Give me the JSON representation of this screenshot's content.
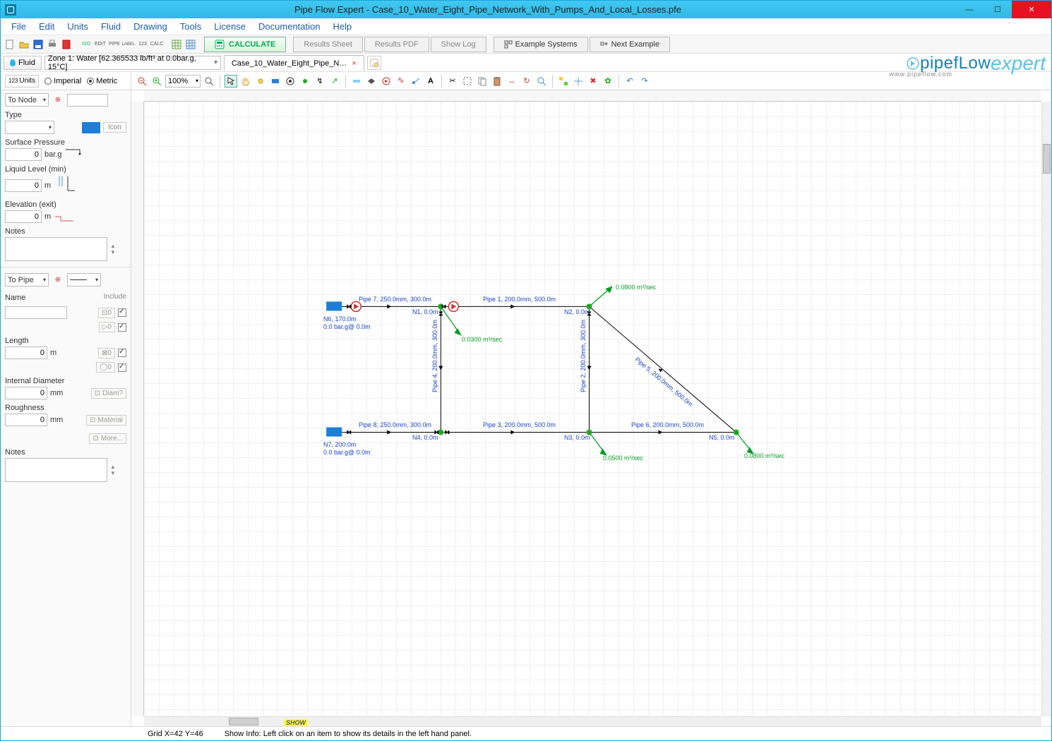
{
  "titlebar": {
    "title": "Pipe Flow Expert - Case_10_Water_Eight_Pipe_Network_With_Pumps_And_Local_Losses.pfe"
  },
  "menu": {
    "file": "File",
    "edit": "Edit",
    "units": "Units",
    "fluid": "Fluid",
    "drawing": "Drawing",
    "tools": "Tools",
    "license": "License",
    "doc": "Documentation",
    "help": "Help"
  },
  "toolbar1": {
    "calc": "CALCULATE",
    "results_sheet": "Results Sheet",
    "results_pdf": "Results PDF",
    "show_log": "Show Log",
    "example_systems": "Example Systems",
    "next_example": "Next Example"
  },
  "toolbar2": {
    "fluid_btn": "Fluid",
    "zone": "Zone 1: Water [62.365533 lb/ft³ at 0.0bar.g, 15°C]",
    "tab": "Case_10_Water_Eight_Pipe_N…"
  },
  "units": {
    "btn": "Units",
    "imperial": "Imperial",
    "metric": "Metric",
    "zoom": "100%"
  },
  "leftpanel": {
    "to_node": "To Node",
    "type_label": "Type",
    "icon_btn": "Icon",
    "surface_pressure": "Surface Pressure",
    "sp_val": "0",
    "sp_unit": "bar.g",
    "liquid_level": "Liquid Level (min)",
    "ll_val": "0",
    "ll_unit": "m",
    "elev_exit": "Elevation (exit)",
    "ee_val": "0",
    "ee_unit": "m",
    "notes": "Notes",
    "to_pipe": "To Pipe",
    "include": "Include",
    "name": "Name",
    "length": "Length",
    "len_val": "0",
    "len_unit": "m",
    "int_dia": "Internal Diameter",
    "dia_val": "0",
    "dia_unit": "mm",
    "diam_btn": "Diam?",
    "rough": "Roughness",
    "rough_val": "0",
    "rough_unit": "mm",
    "material_btn": "Material",
    "more": "More..."
  },
  "diagram": {
    "pipe7": "Pipe 7, 250.0mm, 300.0m",
    "pipe1": "Pipe 1, 200.0mm, 500.0m",
    "pipe8": "Pipe 8, 250.0mm, 300.0m",
    "pipe3": "Pipe 3, 200.0mm, 500.0m",
    "pipe6": "Pipe 6, 200.0mm, 500.0m",
    "pipe5": "Pipe 5, 200.0mm, 500.0m",
    "pipe4": "Pipe 4, 200.0mm, 300.0m",
    "pipe2": "Pipe 2, 200.0mm, 300.0m",
    "n1": "N1, 0.0m",
    "n2": "N2, 0.0m",
    "n3": "N3, 0.0m",
    "n4": "N4, 0.0m",
    "n5": "N5, 0.0m",
    "n6a": "N6, 170.0m",
    "n6b": "0.0 bar.g@ 0.0m",
    "n7a": "N7, 200.0m",
    "n7b": "0.0 bar.g@ 0.0m",
    "q1": "0.0800 m³/sec",
    "q2": "0.0300 m³/sec",
    "q3": "0.0500 m³/sec",
    "q4": "0.0800 m³/sec"
  },
  "canvas": {
    "show": "SHOW"
  },
  "status": {
    "grid": "Grid  X=42  Y=46",
    "info": "Show Info: Left click on an item to show its details in the left hand panel."
  },
  "logo": {
    "brand": "pipefLow",
    "prod": "expert",
    "url": "www.pipeflow.com"
  }
}
